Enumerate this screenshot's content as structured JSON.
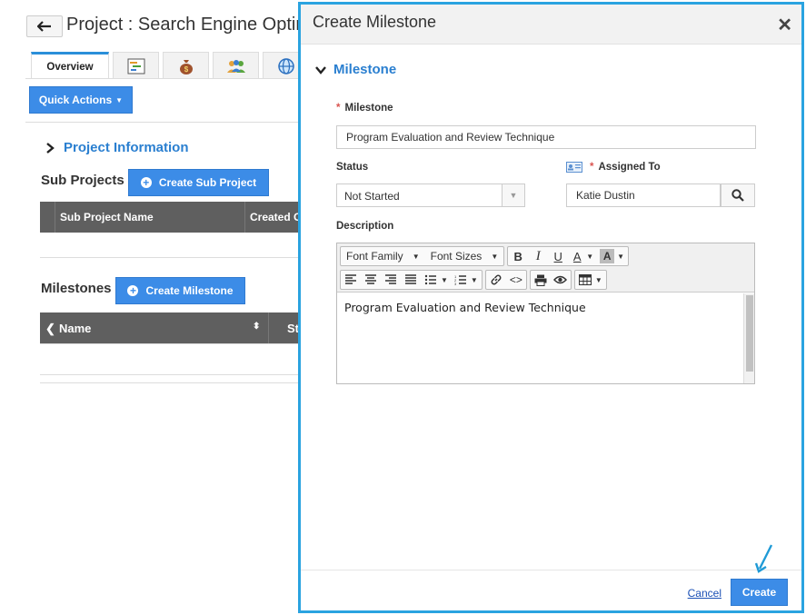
{
  "page": {
    "title": "Project : Search Engine Optimiz",
    "tabs": [
      {
        "label": "Overview",
        "icon": "overview"
      },
      {
        "label": "",
        "icon": "gantt-chart-icon"
      },
      {
        "label": "",
        "icon": "money-bag-icon"
      },
      {
        "label": "",
        "icon": "team-icon"
      },
      {
        "label": "",
        "icon": "globe-icon"
      }
    ],
    "quick_actions_label": "Quick Actions",
    "project_information_label": "Project Information",
    "sub_projects": {
      "heading": "Sub Projects",
      "create_label": "Create Sub Project",
      "columns": [
        "Sub Project Name",
        "Created C"
      ]
    },
    "milestones": {
      "heading": "Milestones",
      "create_label": "Create Milestone",
      "columns": [
        "Name",
        "St"
      ]
    }
  },
  "modal": {
    "title": "Create Milestone",
    "section_label": "Milestone",
    "fields": {
      "milestone": {
        "label": "Milestone",
        "required": true,
        "value": "Program Evaluation and Review Technique"
      },
      "status": {
        "label": "Status",
        "value": "Not Started"
      },
      "assigned_to": {
        "label": "Assigned To",
        "required": true,
        "value": "Katie Dustin"
      },
      "description": {
        "label": "Description",
        "value": "Program Evaluation and Review Technique"
      }
    },
    "editor_toolbar": {
      "font_family": "Font Family",
      "font_sizes": "Font Sizes",
      "bold": "B",
      "italic": "I",
      "underline": "U",
      "text_color": "A",
      "bg_color": "A"
    },
    "cancel_label": "Cancel",
    "create_label": "Create"
  },
  "colors": {
    "accent": "#3c8ce7",
    "modal_border": "#2aa3e0",
    "link": "#2a7fd0",
    "required": "#d9534f"
  }
}
